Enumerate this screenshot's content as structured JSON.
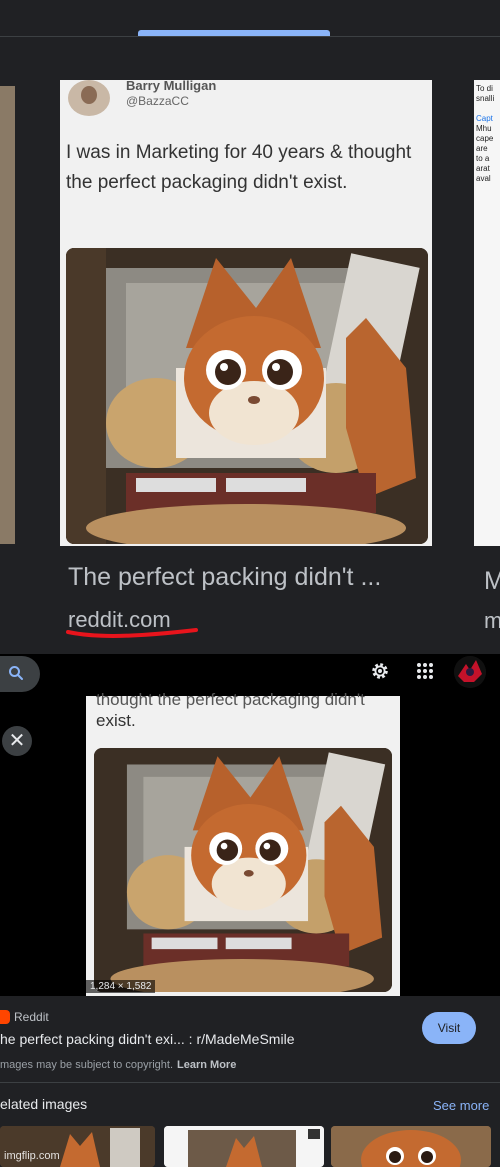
{
  "top_result": {
    "tweet": {
      "name": "Barry Mulligan",
      "handle": "@BazzaCC",
      "text": "I was in Marketing for 40 years & thought the perfect packaging didn't exist."
    },
    "title": "The perfect packing didn't ...",
    "source": "reddit.com",
    "right_cut_title": "M",
    "right_cut_source": "m",
    "right_snippet": [
      "To di",
      "snalli",
      "",
      "Capt",
      "Mhu",
      "cape",
      "are",
      "to a",
      "arat",
      "aval"
    ]
  },
  "toolbar": {
    "search_icon": "search-icon",
    "settings_icon": "gear-icon",
    "apps_icon": "apps-grid-icon"
  },
  "viewer": {
    "partial_line": "thought the perfect packaging didn't",
    "text_line": "exist.",
    "dimensions": "1,284 × 1,582",
    "source_name": "Reddit",
    "title": "he perfect packing didn't exi... : r/MadeMeSmile",
    "visit_label": "Visit",
    "copyright": "mages may be subject to copyright.",
    "learn_more": "Learn More",
    "related_title": "elated images",
    "see_more": "See more"
  },
  "watermark": "imgflip.com",
  "colors": {
    "accent": "#8ab4f8",
    "background": "#202124",
    "highlight_underline": "#e8141c",
    "reddit": "#ff4500"
  }
}
